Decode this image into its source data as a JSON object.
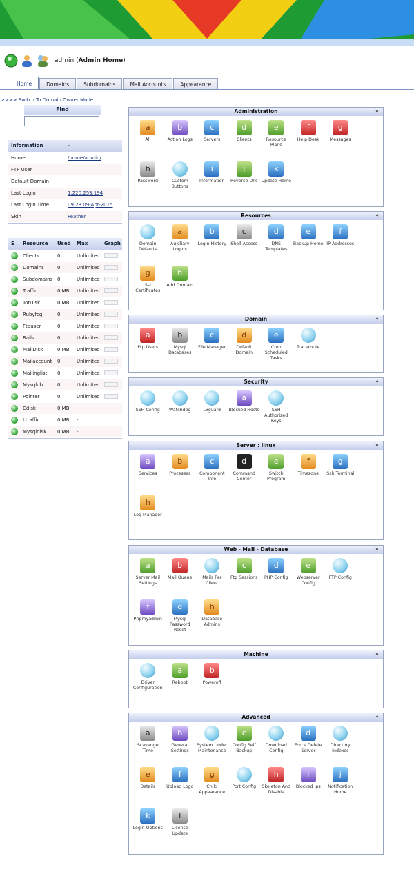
{
  "user": {
    "name": "admin",
    "context": "Admin Home"
  },
  "tabs": [
    {
      "label": "Home",
      "active": true
    },
    {
      "label": "Domains",
      "active": false
    },
    {
      "label": "Subdomains",
      "active": false
    },
    {
      "label": "Mail Accounts",
      "active": false
    },
    {
      "label": "Appearance",
      "active": false
    }
  ],
  "switch_link": ">>>> Switch To Domain Owner Mode",
  "find": {
    "label": "Find",
    "value": ""
  },
  "info": {
    "header": [
      "Information",
      "-"
    ],
    "rows": [
      [
        "Home",
        "/home/admin/"
      ],
      [
        "FTP User",
        ""
      ],
      [
        "Default Domain",
        ""
      ],
      [
        "Last Login",
        "1.220.253.194"
      ],
      [
        "Last Login Time",
        "09.28.09-Apr-2015"
      ],
      [
        "Skin",
        "Feather"
      ]
    ]
  },
  "resources": {
    "header": [
      "S",
      "Resource",
      "Used",
      "Max",
      "Graph"
    ],
    "rows": [
      [
        "Clients",
        "0",
        "Unlimited",
        true
      ],
      [
        "Domains",
        "0",
        "Unlimited",
        true
      ],
      [
        "Subdomains",
        "0",
        "Unlimited",
        true
      ],
      [
        "Traffic",
        "0 MB",
        "Unlimited",
        true
      ],
      [
        "TotDisk",
        "0 MB",
        "Unlimited",
        true
      ],
      [
        "Rubyfcgi",
        "0",
        "Unlimited",
        true
      ],
      [
        "Ftpuser",
        "0",
        "Unlimited",
        true
      ],
      [
        "Rails",
        "0",
        "Unlimited",
        true
      ],
      [
        "MailDisk",
        "0 MB",
        "Unlimited",
        true
      ],
      [
        "Mailaccount",
        "0",
        "Unlimited",
        true
      ],
      [
        "Mailinglist",
        "0",
        "Unlimited",
        true
      ],
      [
        "Mysqldb",
        "0",
        "Unlimited",
        true
      ],
      [
        "Pointer",
        "0",
        "Unlimited",
        true
      ],
      [
        "Cdisk",
        "0 MB",
        "-",
        false
      ],
      [
        "Ltraffic",
        "0 MB",
        "-",
        false
      ],
      [
        "Mysqldisk",
        "0 MB",
        "-",
        false
      ]
    ]
  },
  "panels": [
    {
      "title": "Administration",
      "items": [
        [
          "All",
          "c1",
          "a"
        ],
        [
          "Action Logs",
          "c5",
          "b"
        ],
        [
          "Servers",
          "c2",
          "c"
        ],
        [
          "Clients",
          "c3",
          "d"
        ],
        [
          "Resource Plans",
          "c3",
          "e"
        ],
        [
          "Help Desk",
          "c4",
          "f"
        ],
        [
          "Messages",
          "c4",
          "g"
        ],
        [
          "Password",
          "c6",
          "h"
        ],
        [
          "Custom Buttons",
          "c0",
          ""
        ],
        [
          "Information",
          "c2",
          "i"
        ],
        [
          "Reverse Dns",
          "c3",
          "j"
        ],
        [
          "Update Home",
          "c2",
          "k"
        ]
      ]
    },
    {
      "title": "Resources",
      "items": [
        [
          "Domain Defaults",
          "c0",
          ""
        ],
        [
          "Auxiliary Logins",
          "c1",
          "a"
        ],
        [
          "Login History",
          "c2",
          "b"
        ],
        [
          "Shell Access",
          "c6",
          "c"
        ],
        [
          "DNS Templates",
          "c2",
          "d"
        ],
        [
          "Backup Home",
          "c2",
          "e"
        ],
        [
          "IP Addresses",
          "c2",
          "f"
        ],
        [
          "Ssl Certificates",
          "c1",
          "g"
        ],
        [
          "Add Domain",
          "c3",
          "h"
        ]
      ]
    },
    {
      "title": "Domain",
      "items": [
        [
          "Ftp Users",
          "c4",
          "a"
        ],
        [
          "Mysql Databases",
          "c6",
          "b"
        ],
        [
          "File Manager",
          "c2",
          "c"
        ],
        [
          "Default Domain",
          "c1",
          "d"
        ],
        [
          "Cron Scheduled Tasks",
          "c2",
          "e"
        ],
        [
          "Traceroute",
          "c0",
          ""
        ]
      ]
    },
    {
      "title": "Security",
      "items": [
        [
          "SSH Config",
          "c0",
          ""
        ],
        [
          "Watchdog",
          "c0",
          ""
        ],
        [
          "Lxguard",
          "c0",
          ""
        ],
        [
          "Blocked Hosts",
          "c5",
          "a"
        ],
        [
          "SSH Authorized Keys",
          "c0",
          ""
        ]
      ]
    },
    {
      "title": "Server : linux",
      "items": [
        [
          "Services",
          "c5",
          "a"
        ],
        [
          "Processes",
          "c1",
          "b"
        ],
        [
          "Component Info",
          "c2",
          "c"
        ],
        [
          "Command Center",
          "c7",
          "d"
        ],
        [
          "Switch Program",
          "c3",
          "e"
        ],
        [
          "Timezone",
          "c1",
          "f"
        ],
        [
          "Ssh Terminal",
          "c2",
          "g"
        ],
        [
          "Log Manager",
          "c1",
          "h"
        ]
      ]
    },
    {
      "title": "Web - Mail - Database",
      "items": [
        [
          "Server Mail Settings",
          "c3",
          "a"
        ],
        [
          "Mail Queue",
          "c4",
          "b"
        ],
        [
          "Mails Per Client",
          "c0",
          ""
        ],
        [
          "Ftp Sessions",
          "c3",
          "c"
        ],
        [
          "PHP Config",
          "c2",
          "d"
        ],
        [
          "Webserver Config",
          "c3",
          "e"
        ],
        [
          "FTP Config",
          "c0",
          ""
        ],
        [
          "Phpmyadmin",
          "c5",
          "f"
        ],
        [
          "Mysql Password Reset",
          "c2",
          "g"
        ],
        [
          "Database Admins",
          "c1",
          "h"
        ]
      ]
    },
    {
      "title": "Machine",
      "items": [
        [
          "Driver Configuration",
          "c0",
          ""
        ],
        [
          "Reboot",
          "c3",
          "a"
        ],
        [
          "Poweroff",
          "c4",
          "b"
        ]
      ]
    },
    {
      "title": "Advanced",
      "items": [
        [
          "Scavenge Time",
          "c6",
          "a"
        ],
        [
          "General Settings",
          "c5",
          "b"
        ],
        [
          "System Under Maintenance",
          "c0",
          ""
        ],
        [
          "Config Self Backup",
          "c3",
          "c"
        ],
        [
          "Download Config",
          "c0",
          ""
        ],
        [
          "Force Delete Server",
          "c2",
          "d"
        ],
        [
          "Directory Indexes",
          "c0",
          ""
        ],
        [
          "Details",
          "c1",
          "e"
        ],
        [
          "Upload Logo",
          "c2",
          "f"
        ],
        [
          "Child Appearance",
          "c1",
          "g"
        ],
        [
          "Port Config",
          "c0",
          ""
        ],
        [
          "Skeleton And Disable",
          "c4",
          "h"
        ],
        [
          "Blocked Ips",
          "c5",
          "i"
        ],
        [
          "Notification Home",
          "c2",
          "j"
        ],
        [
          "Login Options",
          "c2",
          "k"
        ],
        [
          "License Update",
          "c6",
          "l"
        ]
      ]
    }
  ]
}
